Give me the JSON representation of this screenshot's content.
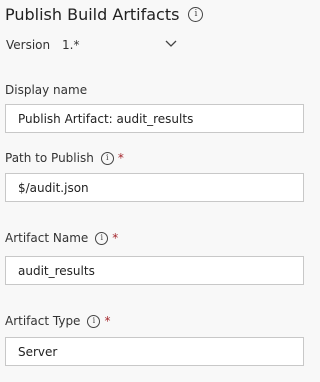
{
  "panel": {
    "title": "Publish Build Artifacts"
  },
  "version": {
    "label": "Version",
    "value": "1.*"
  },
  "fields": {
    "display_name": {
      "label": "Display name",
      "value": "Publish Artifact: audit_results"
    },
    "path_to_publish": {
      "label": "Path to Publish",
      "required_marker": "*",
      "value": "$/audit.json"
    },
    "artifact_name": {
      "label": "Artifact Name",
      "required_marker": "*",
      "value": "audit_results"
    },
    "artifact_type": {
      "label": "Artifact Type",
      "required_marker": "*",
      "value": "Server"
    }
  },
  "icons": {
    "info": "info-icon",
    "chevron": "chevron-down-icon"
  },
  "colors": {
    "background": "#f8f8f8",
    "input_border": "#c8c8c8",
    "required": "#a4262c"
  }
}
